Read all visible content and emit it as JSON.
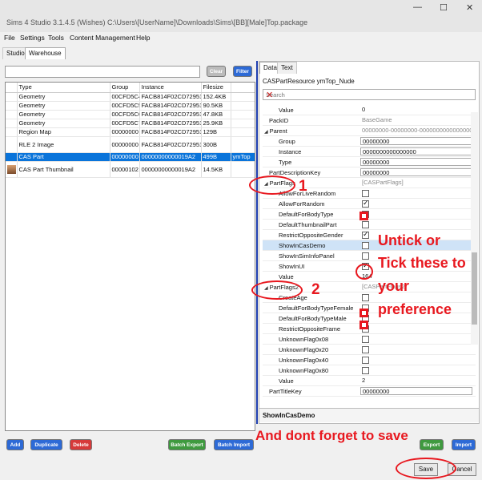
{
  "window": {
    "title": "Sims 4 Studio 3.1.4.5 (Wishes)  C:\\Users\\[UserName]\\Downloads\\Sims\\[BB][Male]Top.package",
    "controls": [
      "—",
      "☐",
      "✕"
    ]
  },
  "menu": [
    "File",
    "Settings",
    "Tools",
    "Content Management",
    "Help"
  ],
  "main_tabs": [
    "Studio",
    "Warehouse"
  ],
  "toolbar": {
    "clear_label": "Clear",
    "filter_label": "Filter"
  },
  "resource_table": {
    "headers": [
      "Type",
      "Group",
      "Instance",
      "Filesize"
    ],
    "rows": [
      {
        "type": "Geometry",
        "group": "00CFD5C4",
        "instance": "FACB814F02CD72951",
        "size": "152.4KB",
        "extra": ""
      },
      {
        "type": "Geometry",
        "group": "00CFD5C5",
        "instance": "FACB814F02CD72951",
        "size": "90.5KB",
        "extra": ""
      },
      {
        "type": "Geometry",
        "group": "00CFD5C6",
        "instance": "FACB814F02CD72951",
        "size": "47.8KB",
        "extra": ""
      },
      {
        "type": "Geometry",
        "group": "00CFD5C7",
        "instance": "FACB814F02CD72951",
        "size": "25.9KB",
        "extra": ""
      },
      {
        "type": "Region Map",
        "group": "00000000",
        "instance": "FACB814F02CD72951",
        "size": "129B",
        "extra": ""
      },
      {
        "type": "RLE 2 Image",
        "group": "00000000",
        "instance": "FACB814F02CD72951",
        "size": "300B",
        "extra": ""
      },
      {
        "type": "CAS Part",
        "group": "00000000",
        "instance": "00000000000019A2",
        "size": "499B",
        "extra": "ymTop"
      },
      {
        "type": "CAS Part Thumbnail",
        "group": "00000102",
        "instance": "00000000000019A2",
        "size": "14.5KB",
        "extra": ""
      }
    ]
  },
  "bottom_buttons": {
    "add": "Add",
    "duplicate": "Duplicate",
    "delete": "Delete",
    "batch_export": "Batch Export",
    "batch_import": "Batch Import",
    "export": "Export",
    "import": "Import"
  },
  "right_tabs": [
    "Data",
    "Text"
  ],
  "resource_header": "CASPartResource  ymTop_Nude",
  "search_placeholder": "Search",
  "properties": {
    "value": {
      "k": "Value",
      "v": "0"
    },
    "packid": {
      "k": "PackID",
      "v": "BaseGame"
    },
    "parent": {
      "k": "Parent",
      "v": "00000000-00000000-0000000000000000"
    },
    "group": {
      "k": "Group",
      "v": "00000000"
    },
    "instance": {
      "k": "Instance",
      "v": "0000000000000000"
    },
    "type": {
      "k": "Type",
      "v": "00000000"
    },
    "part_desc_key": {
      "k": "PartDescriptionKey",
      "v": "00000000"
    },
    "partflags": {
      "k": "PartFlags",
      "v": "[CASPartFlags]"
    },
    "allow_live_random": {
      "k": "AllowForLiveRandom",
      "checked": false
    },
    "allow_random": {
      "k": "AllowForRandom",
      "checked": true
    },
    "default_body_type": {
      "k": "DefaultForBodyType",
      "checked": false
    },
    "default_thumb": {
      "k": "DefaultThumbnailPart",
      "checked": false
    },
    "restrict_opp_gender": {
      "k": "RestrictOppositeGender",
      "checked": true
    },
    "show_cas_demo": {
      "k": "ShowInCasDemo",
      "checked": false
    },
    "show_sim_info": {
      "k": "ShowInSimInfoPanel",
      "checked": false
    },
    "show_ui": {
      "k": "ShowInUI",
      "checked": true
    },
    "flags_value": {
      "k": "Value",
      "v": "164"
    },
    "partflags2": {
      "k": "PartFlags2",
      "v": "[CASPartFlags2]"
    },
    "create_age": {
      "k": "CreateAge",
      "checked": false
    },
    "def_body_female": {
      "k": "DefaultForBodyTypeFemale",
      "checked": false
    },
    "def_body_male": {
      "k": "DefaultForBodyTypeMale",
      "checked": false
    },
    "restrict_opp_frame": {
      "k": "RestrictOppositeFrame",
      "checked": false
    },
    "unk08": {
      "k": "UnknownFlag0x08",
      "checked": false
    },
    "unk20": {
      "k": "UnknownFlag0x20",
      "checked": false
    },
    "unk40": {
      "k": "UnknownFlag0x40",
      "checked": false
    },
    "unk80": {
      "k": "UnknownFlag0x80",
      "checked": false
    },
    "flags2_value": {
      "k": "Value",
      "v": "2"
    },
    "part_title_key": {
      "k": "PartTitleKey",
      "v": "00000000"
    }
  },
  "description_title": "ShowInCasDemo",
  "annotations": {
    "one": "1",
    "two": "2",
    "untick_line1": "Untick or",
    "untick_line2": "Tick these to",
    "untick_line3": "your",
    "untick_line4": "preference",
    "save_note": "And dont forget to save"
  },
  "actions": {
    "save": "Save",
    "cancel": "Cancel"
  },
  "colors": {
    "accent": "#e8181f",
    "selection": "#0a74da",
    "divider": "#1f3fb0"
  }
}
